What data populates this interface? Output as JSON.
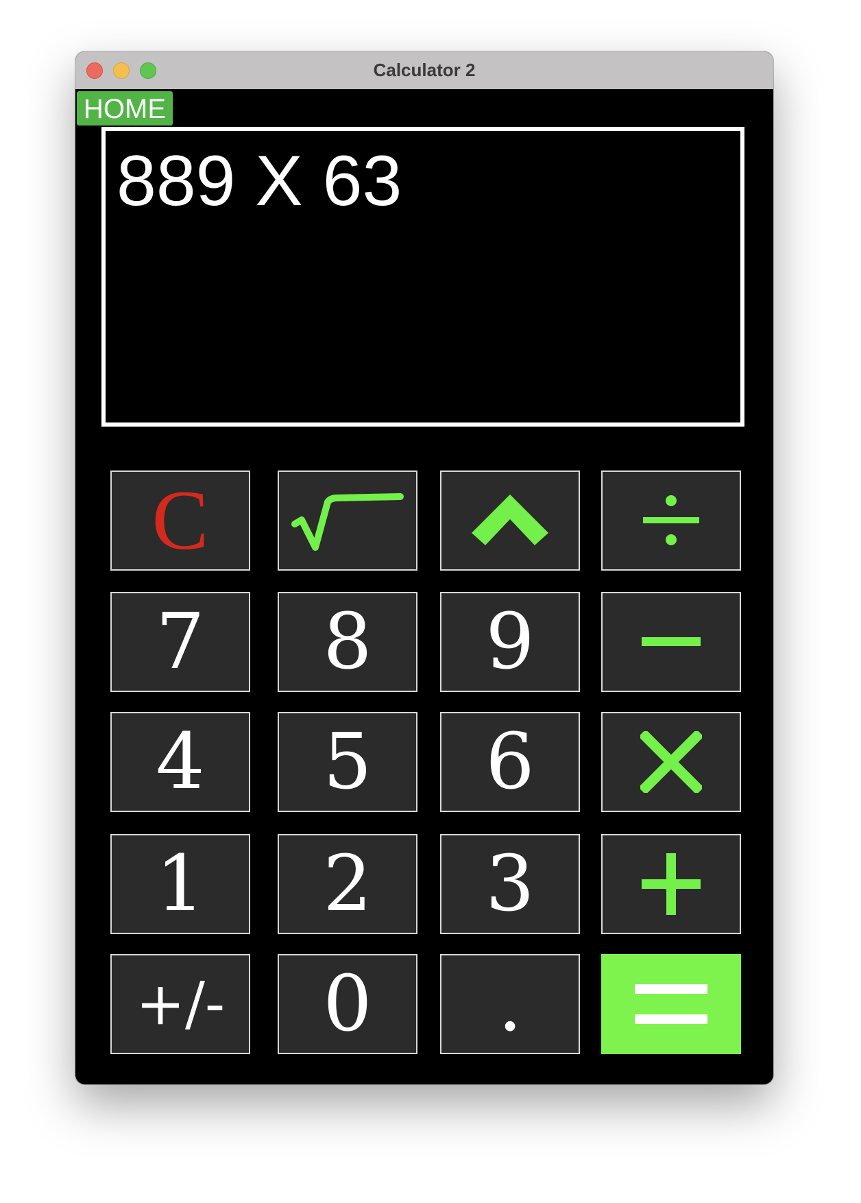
{
  "window": {
    "title": "Calculator 2"
  },
  "home_button": {
    "label": "HOME"
  },
  "display": {
    "expression": "889 X 63"
  },
  "keys": {
    "clear": "C",
    "sqrt": "sqrt-icon",
    "power": "caret-up-icon",
    "divide": "÷",
    "seven": "7",
    "eight": "8",
    "nine": "9",
    "minus": "minus-icon",
    "four": "4",
    "five": "5",
    "six": "6",
    "multiply": "multiply-icon",
    "one": "1",
    "two": "2",
    "three": "3",
    "plus": "plus-icon",
    "negate": "+/-",
    "zero": "0",
    "decimal": ".",
    "equals": "equals-icon"
  },
  "colors": {
    "background": "#000000",
    "key_face": "#2b2b2b",
    "accent_green": "#74f04a",
    "equals_green": "#7ef34e",
    "clear_red": "#d42a1c",
    "home_green": "#52b447"
  }
}
